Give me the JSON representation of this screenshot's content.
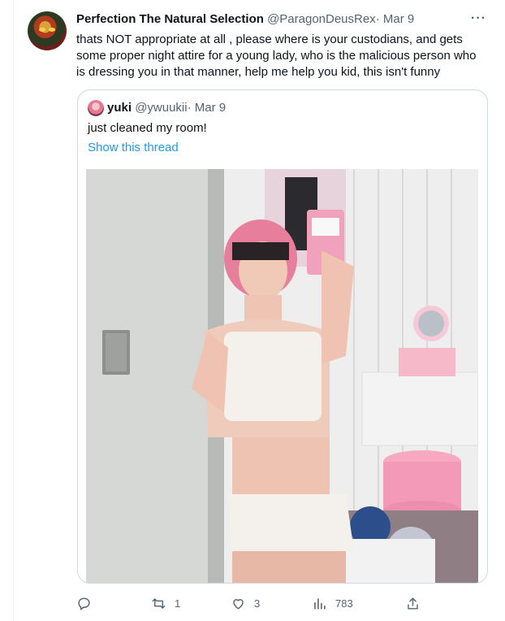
{
  "tweet": {
    "author_name": "Perfection The Natural Selection",
    "author_handle": "@ParagonDeusRex",
    "separator": "·",
    "date": "Mar 9",
    "more_icon": "more-dots-icon",
    "text": "thats NOT appropriate at all , please where is your custodians, and gets some proper night attire for a young lady, who is the malicious person who is dressing you in that manner, help me help you kid, this isn't funny"
  },
  "quoted_tweet": {
    "author_name": "yuki",
    "author_handle": "@ywuukii",
    "separator": "·",
    "date": "Mar 9",
    "text": "just cleaned my room!",
    "thread_link": "Show this thread",
    "image_alt": "mirror selfie in a bedroom"
  },
  "actions": {
    "reply": {
      "icon": "reply-icon",
      "count": ""
    },
    "retweet": {
      "icon": "retweet-icon",
      "count": "1"
    },
    "like": {
      "icon": "heart-icon",
      "count": "3"
    },
    "views": {
      "icon": "views-chart-icon",
      "count": "783"
    },
    "share": {
      "icon": "share-icon",
      "count": ""
    }
  },
  "colors": {
    "accent": "#1d9bf0",
    "secondary_text": "#536471",
    "border": "#cfd9de"
  }
}
